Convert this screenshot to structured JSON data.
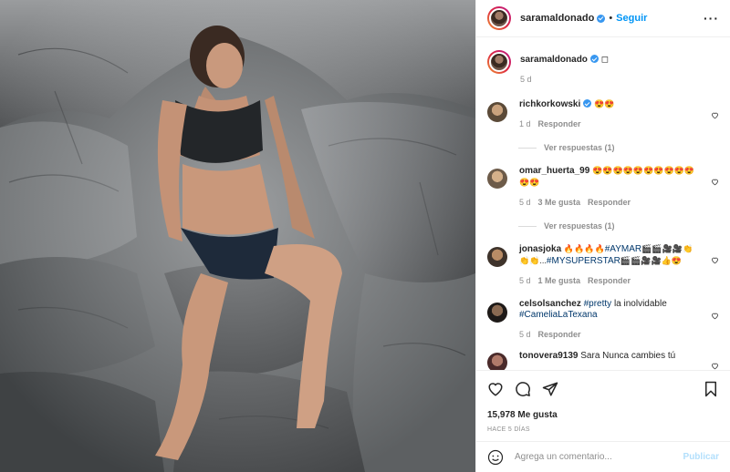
{
  "post": {
    "username": "saramaldonado",
    "follow_label": "Seguir",
    "dot": "•",
    "more_label": "..."
  },
  "caption": {
    "username": "saramaldonado",
    "text": "◻",
    "time": "5 d"
  },
  "comments": [
    {
      "username": "richkorkowski",
      "text": "😍😍",
      "time": "1 d",
      "likes": "",
      "reply": "Responder",
      "view_replies": "Ver respuestas (1)"
    },
    {
      "username": "omar_huerta_99",
      "text": "😍😍😍😍😍😍😍😍😍😍😍😍",
      "time": "5 d",
      "likes": "3 Me gusta",
      "reply": "Responder",
      "view_replies": "Ver respuestas (1)"
    },
    {
      "username": "jonasjoka",
      "text": "🔥🔥🔥🔥",
      "hashtag1": "#AYMAR",
      "text2": "🎬🎬🎥🎥👏👏👏...",
      "hashtag2": "#MYSUPERSTAR",
      "text3": "🎬🎬🎥🎥👍😍",
      "time": "5 d",
      "likes": "1 Me gusta",
      "reply": "Responder"
    },
    {
      "username": "celsolsanchez",
      "hashtag1": "#pretty",
      "text": " la inolvidable ",
      "hashtag2": "#CameliaLaTexana",
      "time": "5 d",
      "likes": "",
      "reply": "Responder"
    },
    {
      "username": "tonovera9139",
      "text": "Sara Nunca cambies tú"
    }
  ],
  "actions": {
    "likes_count": "15,978 Me gusta",
    "time_ago": "HACE 5 DÍAS"
  },
  "add_comment": {
    "placeholder": "Agrega un comentario...",
    "publish_label": "Publicar"
  },
  "colors": {
    "accent": "#0095f6",
    "verified": "#3897f0",
    "hashtag": "#00376b",
    "muted": "#8e8e8e",
    "publish_disabled": "#b2dffc"
  }
}
